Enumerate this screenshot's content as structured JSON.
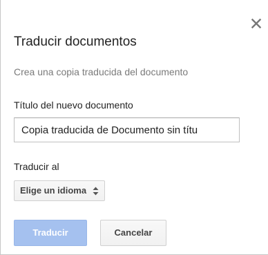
{
  "dialog": {
    "title": "Traducir documentos",
    "subtitle": "Crea una copia traducida del documento",
    "name_label": "Título del nuevo documento",
    "name_value": "Copia traducida de Documento sin títu",
    "language_label": "Traducir al",
    "language_select_value": "Elige un idioma",
    "translate_button": "Traducir",
    "cancel_button": "Cancelar",
    "close_icon": "close-icon",
    "select_arrows_icon": "up-down-arrows-icon"
  },
  "colors": {
    "primary_button_bg": "#a5c1ef",
    "subtitle_text": "#7a7a7a",
    "close_icon": "#777777"
  }
}
